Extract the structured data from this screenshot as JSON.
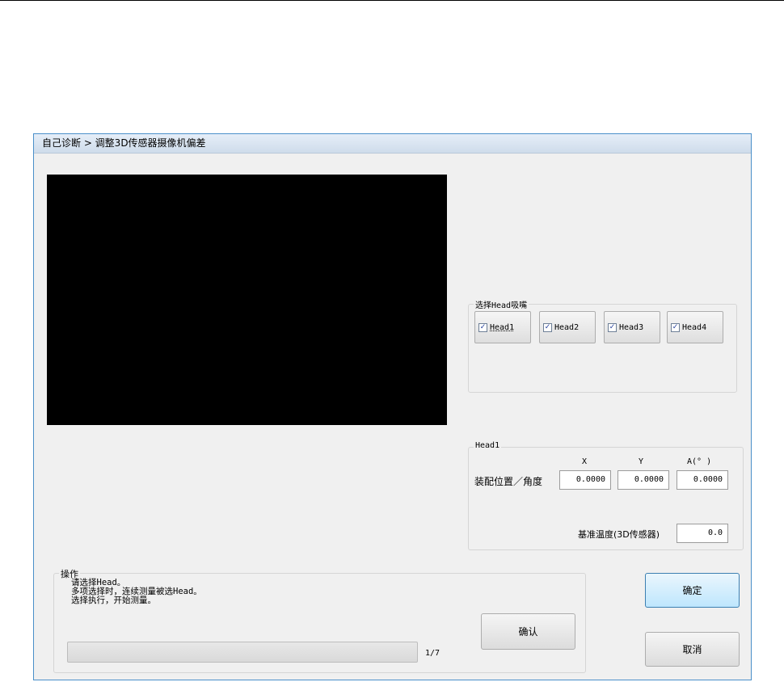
{
  "breadcrumb": "自己诊断 > 调整3D传感器摄像机偏差",
  "head_select": {
    "group_label": "选择Head吸嘴",
    "heads": [
      {
        "label": "Head1",
        "checked": true
      },
      {
        "label": "Head2",
        "checked": true
      },
      {
        "label": "Head3",
        "checked": true
      },
      {
        "label": "Head4",
        "checked": true
      }
    ]
  },
  "offset": {
    "group_label": "Head1",
    "col_x": "X",
    "col_y": "Y",
    "col_a": "A(° )",
    "row_label": "装配位置／角度",
    "x_value": "0.0000",
    "y_value": "0.0000",
    "a_value": "0.0000",
    "temp_label": "基准温度(3D传感器)",
    "temp_value": "0.0"
  },
  "operation": {
    "group_label": "操作",
    "lines": [
      "请选择Head。",
      "多项选择时，连续测量被选Head。",
      "选择执行，开始测量。"
    ],
    "confirm_label": "确认",
    "progress_text": "1/7",
    "progress_fraction": 0
  },
  "buttons": {
    "ok_label": "确定",
    "cancel_label": "取消"
  },
  "colors": {
    "dialog_border": "#4a8fc9",
    "primary_button": "#bee6fd",
    "checkmark": "#24409c"
  }
}
